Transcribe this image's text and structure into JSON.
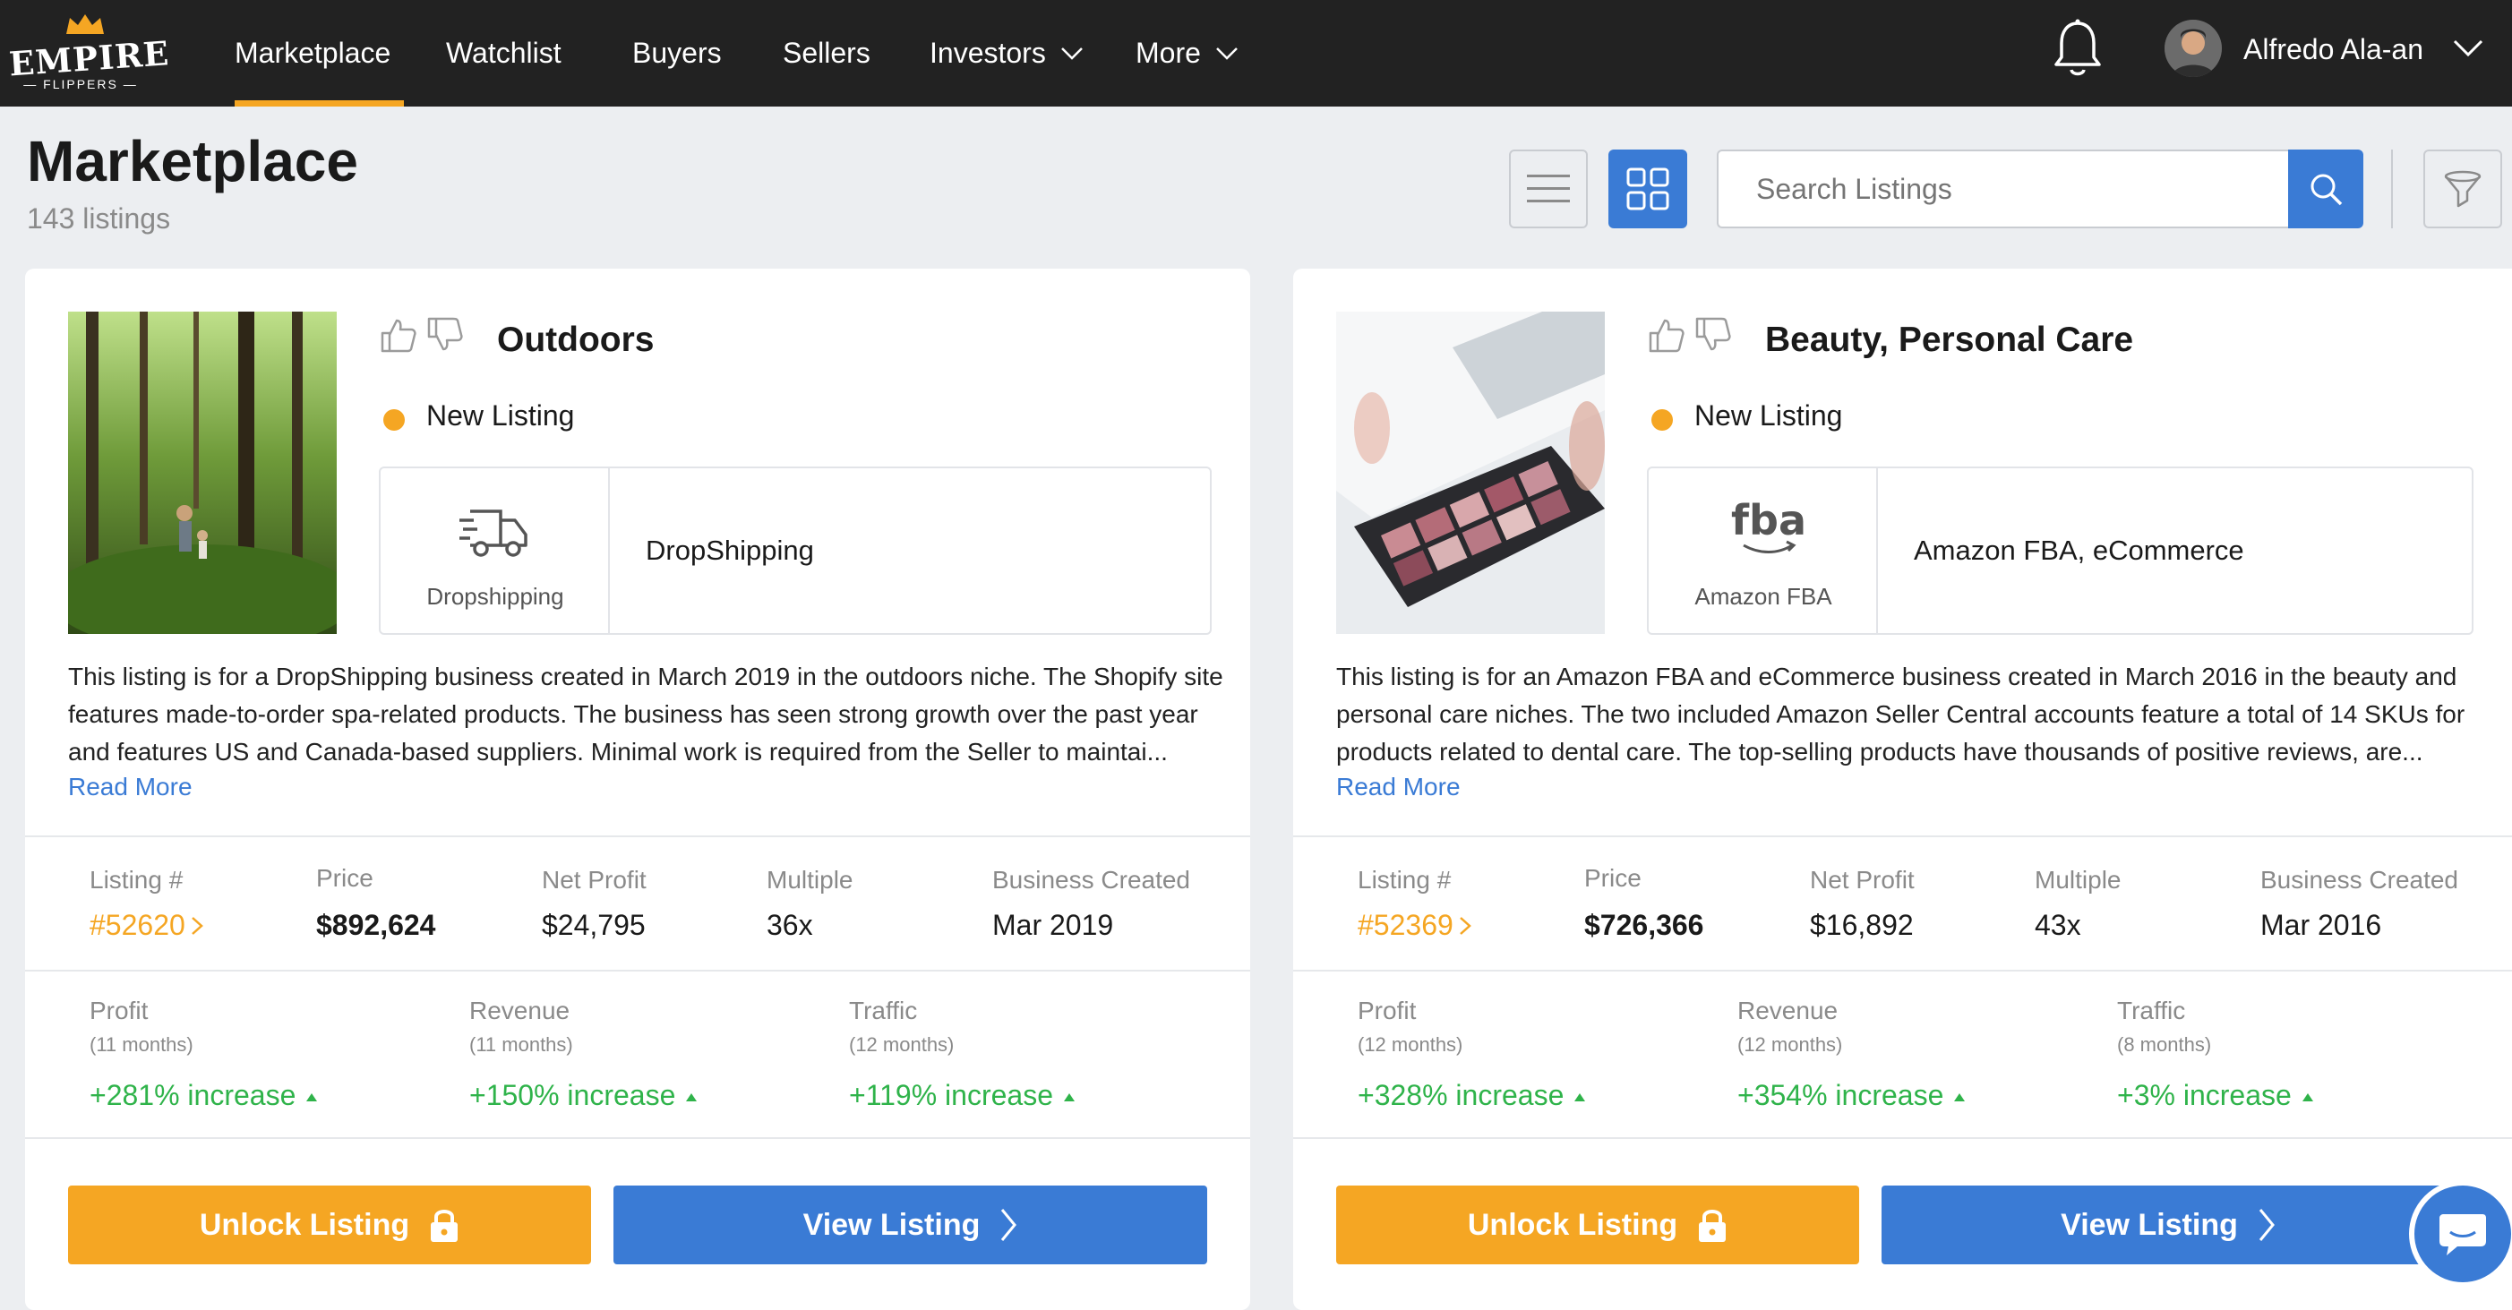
{
  "brand": {
    "name": "EMPIRE",
    "sub": "— FLIPPERS —",
    "accent": "#f5a623",
    "primary": "#3a7bd5"
  },
  "nav": {
    "items": [
      {
        "label": "Marketplace",
        "active": true
      },
      {
        "label": "Watchlist"
      },
      {
        "label": "Buyers"
      },
      {
        "label": "Sellers"
      },
      {
        "label": "Investors",
        "dropdown": true
      },
      {
        "label": "More",
        "dropdown": true
      }
    ],
    "user": {
      "name": "Alfredo Ala-an"
    },
    "icons": [
      "bell-icon",
      "avatar",
      "chevron-down-icon"
    ]
  },
  "header": {
    "title": "Marketplace",
    "count": "143 listings",
    "search_placeholder": "Search Listings",
    "icons": [
      "list-view-icon",
      "grid-view-icon",
      "search-icon",
      "filter-icon"
    ]
  },
  "listings": [
    {
      "niche": "Outdoors",
      "status": "New Listing",
      "model_icon": "truck-icon",
      "model_label": "Dropshipping",
      "model_desc": "DropShipping",
      "description": "This listing is for a DropShipping business created in March 2019 in the outdoors niche. The Shopify site features made-to-order spa-related products. The business has seen strong growth over the past year and features US and Canada-based suppliers. Minimal work is required from the Seller to maintai...",
      "read_more": "Read More",
      "stats": {
        "listing_label": "Listing #",
        "listing_num": "#52620",
        "price_label": "Price",
        "price": "$892,624",
        "profit_label": "Net Profit",
        "profit": "$24,795",
        "multiple_label": "Multiple",
        "multiple": "36x",
        "created_label": "Business Created",
        "created": "Mar 2019"
      },
      "metrics": [
        {
          "label": "Profit",
          "period": "(11 months)",
          "value": "+281% increase"
        },
        {
          "label": "Revenue",
          "period": "(11 months)",
          "value": "+150% increase"
        },
        {
          "label": "Traffic",
          "period": "(12 months)",
          "value": "+119% increase"
        }
      ],
      "unlock_label": "Unlock Listing",
      "view_label": "View Listing"
    },
    {
      "niche": "Beauty, Personal Care",
      "status": "New Listing",
      "model_icon": "fba-icon",
      "model_icon_text": "fba",
      "model_label": "Amazon FBA",
      "model_desc": "Amazon FBA, eCommerce",
      "description": "This listing is for an Amazon FBA and eCommerce business created in March 2016 in the beauty and personal care niches. The two included Amazon Seller Central accounts feature a total of 14 SKUs for products related to dental care. The top-selling products have thousands of positive reviews, are...",
      "read_more": "Read More",
      "stats": {
        "listing_label": "Listing #",
        "listing_num": "#52369",
        "price_label": "Price",
        "price": "$726,366",
        "profit_label": "Net Profit",
        "profit": "$16,892",
        "multiple_label": "Multiple",
        "multiple": "43x",
        "created_label": "Business Created",
        "created": "Mar 2016"
      },
      "metrics": [
        {
          "label": "Profit",
          "period": "(12 months)",
          "value": "+328% increase"
        },
        {
          "label": "Revenue",
          "period": "(12 months)",
          "value": "+354% increase"
        },
        {
          "label": "Traffic",
          "period": "(8 months)",
          "value": "+3% increase"
        }
      ],
      "unlock_label": "Unlock Listing",
      "view_label": "View Listing"
    }
  ]
}
